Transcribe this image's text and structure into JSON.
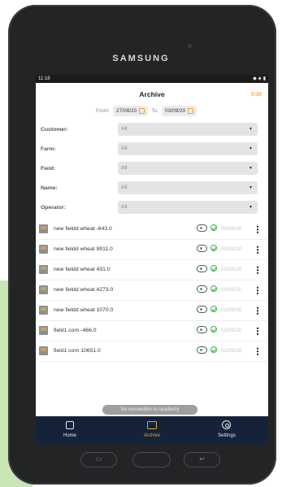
{
  "device": {
    "brand": "SAMSUNG"
  },
  "status_bar": {
    "time": "11:18"
  },
  "header": {
    "title": "Archive",
    "edit_label": "Edit"
  },
  "date_range": {
    "from_label": "From:",
    "from_value": "27/08/20",
    "to_label": "To:",
    "to_value": "03/09/20"
  },
  "filters": [
    {
      "label": "Customer:",
      "value": "All"
    },
    {
      "label": "Farm:",
      "value": "All"
    },
    {
      "label": "Field:",
      "value": "All"
    },
    {
      "label": "Name:",
      "value": "All"
    },
    {
      "label": "Operator:",
      "value": "All"
    }
  ],
  "records": [
    {
      "name": "new fieldd wheat -643.0",
      "date": "03/09/20"
    },
    {
      "name": "new fieldd wheat 9911.0",
      "date": "03/09/20"
    },
    {
      "name": "new fieldd wheat 431.0",
      "date": "03/09/20"
    },
    {
      "name": "new fieldd wheat 4273.0",
      "date": "03/09/20"
    },
    {
      "name": "new fieldd wheat 1070.0",
      "date": "02/09/20"
    },
    {
      "name": "field1 corn -466.0",
      "date": "02/09/20"
    },
    {
      "name": "field1 corn 10651.0",
      "date": "02/09/20"
    }
  ],
  "toast": "No connection to raspberry",
  "bottom_nav": [
    {
      "label": "Home",
      "icon": "home-icon"
    },
    {
      "label": "Archive",
      "icon": "archive-icon",
      "active": true
    },
    {
      "label": "Settings",
      "icon": "gear-icon"
    }
  ],
  "colors": {
    "accent": "#f0a020",
    "nav_bg": "#15233a",
    "success": "#3bb34a"
  }
}
